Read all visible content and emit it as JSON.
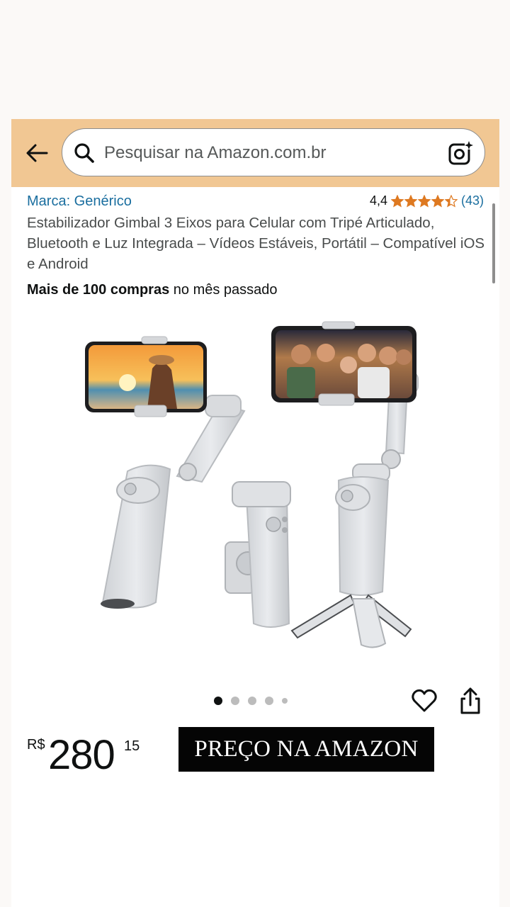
{
  "search": {
    "placeholder": "Pesquisar na Amazon.com.br"
  },
  "product": {
    "brand": "Marca: Genérico",
    "rating": "4,4",
    "rating_stars": 4.4,
    "rating_count": "(43)",
    "title": "Estabilizador Gimbal 3 Eixos para Celular com Tripé Articulado, Bluetooth e Luz Integrada – Vídeos Estáveis, Portátil – Compatível iOS e Android",
    "purchases_bold": "Mais de 100 compras",
    "purchases_rest": " no mês passado",
    "gallery": {
      "image_count": 5,
      "active_index": 0
    },
    "price": {
      "currency": "R$",
      "whole": "280",
      "fraction": "15"
    },
    "cta_label": "PREÇO NA AMAZON"
  },
  "colors": {
    "header_bg": "#f1c793",
    "link": "#1a6e9f",
    "star": "#de7921",
    "cta_bg": "#050505"
  },
  "icons": [
    "back-arrow-icon",
    "search-icon",
    "camera-lens-icon",
    "star-icon",
    "heart-icon",
    "share-icon"
  ]
}
